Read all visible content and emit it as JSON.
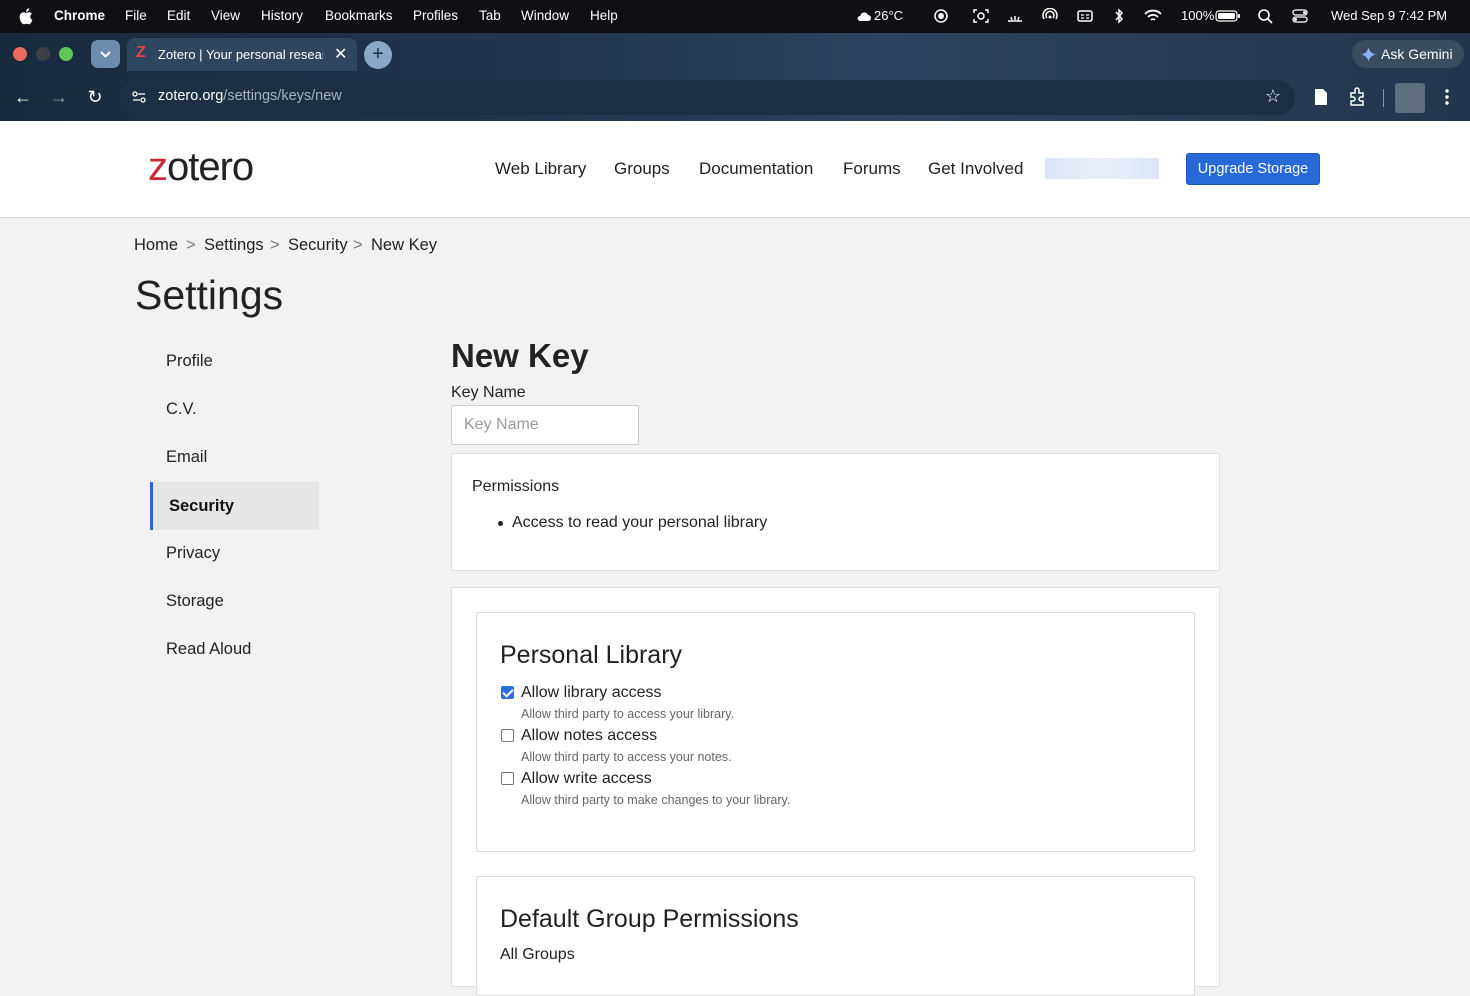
{
  "menubar": {
    "app": "Chrome",
    "items": [
      "File",
      "Edit",
      "View",
      "History",
      "Bookmarks",
      "Profiles",
      "Tab",
      "Window",
      "Help"
    ],
    "weather": "26°C",
    "battery": "100%",
    "datetime": "Wed Sep 9  7:42 PM"
  },
  "browser": {
    "tab_title": "Zotero | Your personal research assistant",
    "gemini_label": "Ask Gemini",
    "url_host": "zotero.org",
    "url_path": "/settings/keys/new"
  },
  "site": {
    "logo": "zotero",
    "nav": [
      "Web Library",
      "Groups",
      "Documentation",
      "Forums",
      "Get Involved"
    ],
    "upgrade_label": "Upgrade Storage"
  },
  "breadcrumb": [
    "Home",
    "Settings",
    "Security",
    "New Key"
  ],
  "breadcrumb_sep": ">",
  "page_title": "Settings",
  "sidebar": {
    "items": [
      "Profile",
      "C.V.",
      "Email",
      "Security",
      "Privacy",
      "Storage",
      "Read Aloud"
    ],
    "active": "Security"
  },
  "form": {
    "heading": "New Key",
    "key_name_label": "Key Name",
    "key_name_placeholder": "Key Name",
    "key_name_value": "",
    "permissions_title": "Permissions",
    "permissions_items": [
      "Access to read your personal library"
    ],
    "personal_library": {
      "heading": "Personal Library",
      "options": [
        {
          "label": "Allow library access",
          "help": "Allow third party to access your library.",
          "checked": true
        },
        {
          "label": "Allow notes access",
          "help": "Allow third party to access your notes.",
          "checked": false
        },
        {
          "label": "Allow write access",
          "help": "Allow third party to make changes to your library.",
          "checked": false
        }
      ]
    },
    "group_permissions": {
      "heading": "Default Group Permissions",
      "sub": "All Groups"
    }
  },
  "colors": {
    "accent": "#2769d6",
    "logo_z": "#cc2936",
    "menubar_bg": "#0f1013",
    "sidebar_active_bar": "#2d66c8"
  }
}
